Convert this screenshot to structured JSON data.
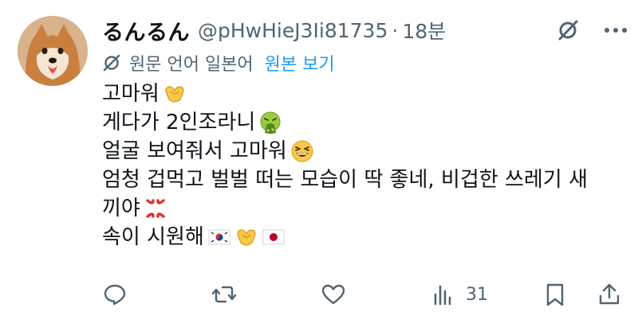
{
  "author": {
    "display_name": "るんるん",
    "handle": "@pHwHieJ3Ii81735",
    "separator": "·",
    "time": "18분",
    "avatar_icon": "shiba-dog-avatar"
  },
  "translation": {
    "label": "원문 언어 일본어",
    "show_original": "원본 보기",
    "icon": "translate-icon"
  },
  "tweet": {
    "lines": [
      "고마워",
      "게다가 2인조라니",
      "얼굴 보여줘서 고마워",
      "엄청 겁먹고 벌벌 떠는 모습이 딱 좋네, 비겁한 쓰레기 새",
      "끼야",
      "속이 시원해"
    ]
  },
  "actions": {
    "reply_icon": "reply-icon",
    "retweet_icon": "retweet-icon",
    "like_icon": "heart-icon",
    "views_icon": "views-icon",
    "views_count": "31",
    "bookmark_icon": "bookmark-icon",
    "share_icon": "share-icon"
  },
  "colors": {
    "text": "#0f1419",
    "muted": "#536471",
    "link": "#1d9bf0"
  }
}
